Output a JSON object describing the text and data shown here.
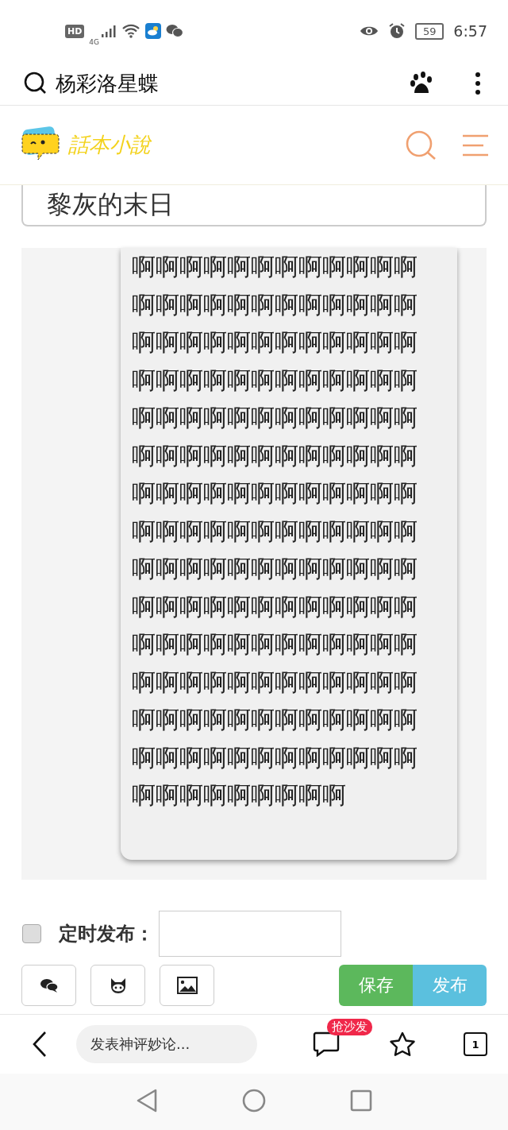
{
  "status_bar": {
    "hd": "HD",
    "network": "4G",
    "battery": "59",
    "time": "6:57"
  },
  "browser_bar": {
    "query": "杨彩洛星蝶"
  },
  "site_header": {
    "logo_text": "話本小說"
  },
  "editor": {
    "title_value": "黎灰的末日",
    "body": "啊啊啊啊啊啊啊啊啊啊啊啊啊啊啊啊啊啊啊啊啊啊啊啊啊啊啊啊啊啊啊啊啊啊啊啊啊啊啊啊啊啊啊啊啊啊啊啊啊啊啊啊啊啊啊啊啊啊啊啊啊啊啊啊啊啊啊啊啊啊啊啊啊啊啊啊啊啊啊啊啊啊啊啊啊啊啊啊啊啊啊啊啊啊啊啊啊啊啊啊啊啊啊啊啊啊啊啊啊啊啊啊啊啊啊啊啊啊啊啊啊啊啊啊啊啊啊啊啊啊啊啊啊啊啊啊啊啊啊啊啊啊啊啊啊啊啊啊啊啊啊啊啊啊啊啊啊啊啊啊啊啊啊啊啊啊啊啊啊啊啊啊啊啊啊啊啊"
  },
  "schedule": {
    "checked": false,
    "label": "定时发布："
  },
  "tools": [
    {
      "kind": "chat"
    },
    {
      "kind": "cat"
    },
    {
      "kind": "image"
    }
  ],
  "actions": [
    {
      "label": "保存",
      "kind": "save"
    },
    {
      "label": "发布",
      "kind": "publish"
    }
  ],
  "bottom_bar": {
    "comment_placeholder": "发表神评妙论...",
    "badge": "抢沙发",
    "tabs_count": "1"
  }
}
